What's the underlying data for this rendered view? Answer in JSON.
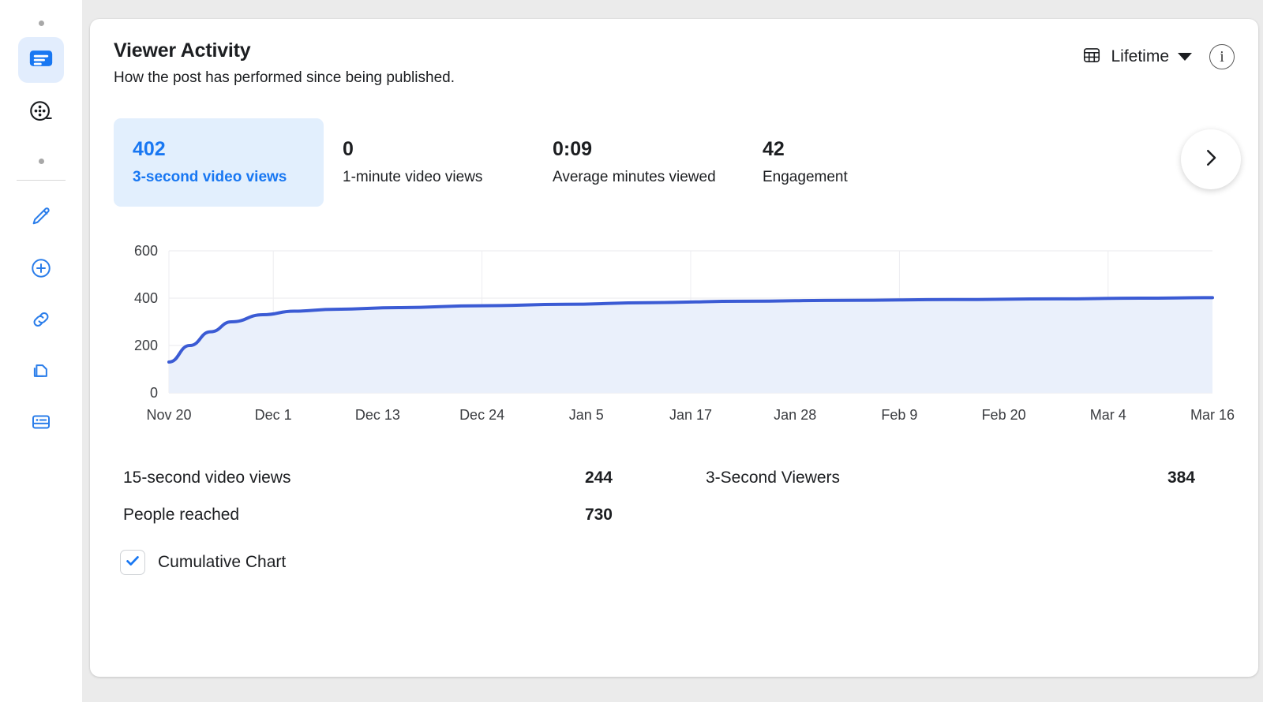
{
  "colors": {
    "accent": "#1877f2",
    "accent_bg": "#e2effd",
    "text": "#1c1e21",
    "line": "#3b5bd4",
    "area": "#eaf0fb"
  },
  "sidebar": {
    "items": [
      {
        "name": "post-insights-icon",
        "label": "Post insights",
        "active": true
      },
      {
        "name": "film-reel-icon",
        "label": "Video",
        "active": false
      }
    ],
    "tools": [
      {
        "name": "pencil-icon",
        "label": "Edit"
      },
      {
        "name": "plus-circle-icon",
        "label": "Add"
      },
      {
        "name": "link-icon",
        "label": "Link"
      },
      {
        "name": "copy-icon",
        "label": "Duplicate"
      },
      {
        "name": "card-icon",
        "label": "Card"
      }
    ]
  },
  "header": {
    "title": "Viewer Activity",
    "subtitle": "How the post has performed since being published.",
    "date_range": "Lifetime",
    "info_glyph": "i"
  },
  "metrics": [
    {
      "value": "402",
      "label": "3-second video views",
      "active": true
    },
    {
      "value": "0",
      "label": "1-minute video views",
      "active": false
    },
    {
      "value": "0:09",
      "label": "Average minutes viewed",
      "active": false
    },
    {
      "value": "42",
      "label": "Engagement",
      "active": false
    }
  ],
  "stats": [
    {
      "name": "15-second video views",
      "value": "244"
    },
    {
      "name": "3-Second Viewers",
      "value": "384"
    },
    {
      "name": "People reached",
      "value": "730"
    }
  ],
  "cumulative": {
    "label": "Cumulative Chart",
    "checked": true
  },
  "chart_data": {
    "type": "area",
    "title": "3-second video views",
    "xlabel": "",
    "ylabel": "",
    "ylim": [
      0,
      600
    ],
    "yticks": [
      0,
      200,
      400,
      600
    ],
    "grid": true,
    "legend": "none",
    "categories": [
      "Nov 20",
      "Dec 1",
      "Dec 13",
      "Dec 24",
      "Jan 5",
      "Jan 17",
      "Jan 28",
      "Feb 9",
      "Feb 20",
      "Mar 4",
      "Mar 16"
    ],
    "series": [
      {
        "name": "3-second video views (cumulative)",
        "values": [
          130,
          352,
          370,
          381,
          389,
          392,
          394,
          396,
          398,
          400,
          402
        ]
      }
    ],
    "detailed_points": [
      {
        "x": 0.0,
        "y": 130
      },
      {
        "x": 0.02,
        "y": 200
      },
      {
        "x": 0.04,
        "y": 258
      },
      {
        "x": 0.06,
        "y": 300
      },
      {
        "x": 0.09,
        "y": 330
      },
      {
        "x": 0.12,
        "y": 345
      },
      {
        "x": 0.16,
        "y": 353
      },
      {
        "x": 0.22,
        "y": 360
      },
      {
        "x": 0.3,
        "y": 368
      },
      {
        "x": 0.38,
        "y": 374
      },
      {
        "x": 0.46,
        "y": 381
      },
      {
        "x": 0.55,
        "y": 387
      },
      {
        "x": 0.65,
        "y": 391
      },
      {
        "x": 0.75,
        "y": 394
      },
      {
        "x": 0.85,
        "y": 397
      },
      {
        "x": 0.93,
        "y": 400
      },
      {
        "x": 1.0,
        "y": 402
      }
    ]
  }
}
